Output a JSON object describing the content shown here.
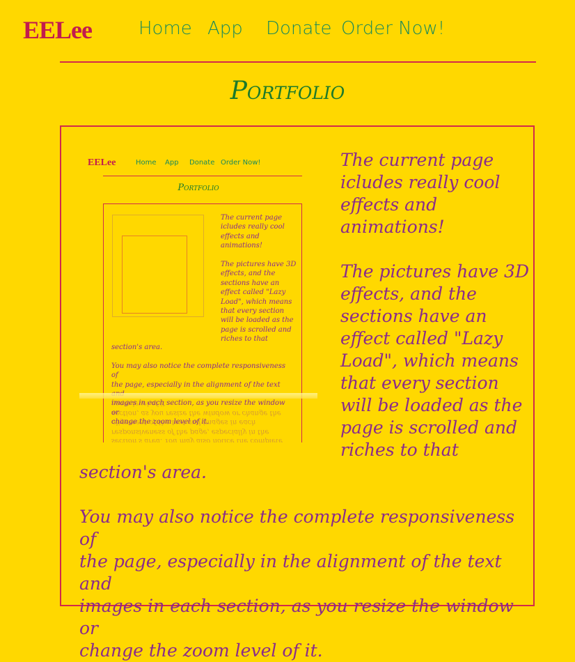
{
  "header": {
    "logo": "EELee",
    "nav": [
      "Home",
      "App",
      "Donate",
      "Order Now!"
    ]
  },
  "page_title": "Portfolio",
  "portfolio": {
    "text_top": "The current page\nicludes really cool\neffects and\nanimations!\n\nThe pictures have 3D\neffects, and the\nsections have an\neffect called \"Lazy\nLoad\", which means\nthat every section\nwill be loaded as the\npage is scrolled and\nriches to that",
    "text_bottom": "section's area.\n\nYou may also notice the complete responsiveness of\nthe page, especially in the alignment of the text and\nimages in each section, as you resize the window or\nchange the zoom level of it."
  },
  "colors": {
    "background": "#ffd800",
    "logo": "#c21b4e",
    "nav": "#1a8a5a",
    "title": "#1c7a2a",
    "text": "#8a2b8b",
    "border": "#d22a4a"
  }
}
